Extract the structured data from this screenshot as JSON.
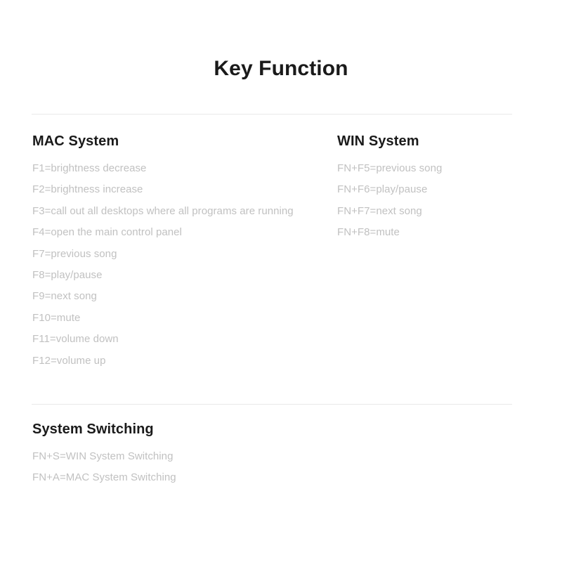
{
  "page": {
    "title": "Key Function",
    "background_color": "#ffffff",
    "heading_color": "#1a1a1a",
    "item_color": "#c1c1c1",
    "divider_color": "#e9e9e9"
  },
  "sections": {
    "mac": {
      "heading": "MAC System",
      "items": [
        "F1=brightness decrease",
        "F2=brightness increase",
        "F3=call out all desktops where all programs are running",
        "F4=open the main control panel",
        "F7=previous song",
        "F8=play/pause",
        "F9=next song",
        "F10=mute",
        "F11=volume down",
        "F12=volume up"
      ]
    },
    "win": {
      "heading": "WIN System",
      "items": [
        "FN+F5=previous song",
        "FN+F6=play/pause",
        "FN+F7=next song",
        "FN+F8=mute"
      ]
    },
    "switching": {
      "heading": "System Switching",
      "items": [
        "FN+S=WIN System Switching",
        "FN+A=MAC System Switching"
      ]
    }
  }
}
